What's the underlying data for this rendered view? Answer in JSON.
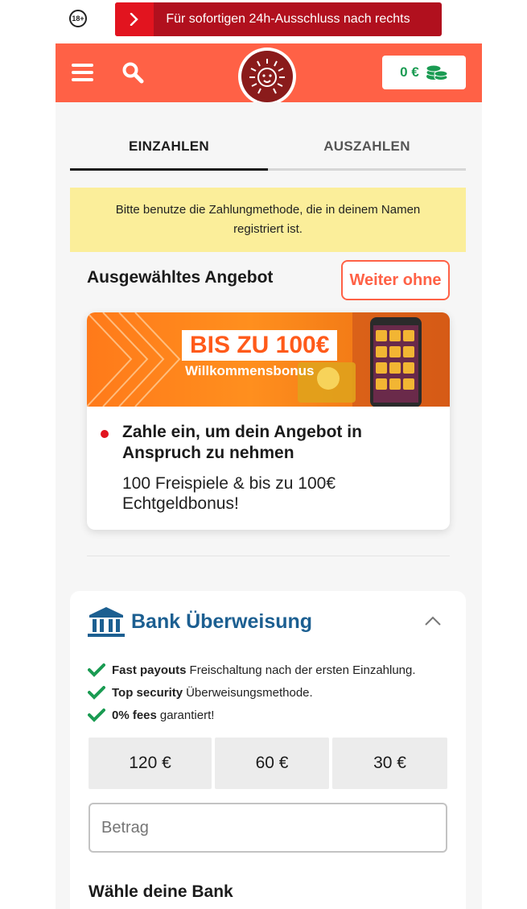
{
  "topbar": {
    "age_badge": "18+",
    "exclusion_text": "Für sofortigen 24h-Ausschluss nach rechts"
  },
  "header": {
    "balance": "0 €",
    "colors": {
      "brand": "#ff6146",
      "balance_green": "#1a9b52"
    }
  },
  "tabs": [
    {
      "label": "EINZAHLEN",
      "active": true
    },
    {
      "label": "AUSZAHLEN",
      "active": false
    }
  ],
  "notice": "Bitte benutze die Zahlungmethode, die in deinem Namen registriert ist.",
  "offer": {
    "section_title": "Ausgewähltes Angebot",
    "skip_label": "Weiter ohne",
    "banner_amount": "BIS ZU 100€",
    "banner_sub": "Willkommensbonus",
    "headline": "Zahle ein, um dein Angebot in Anspruch zu nehmen",
    "description": "100 Freispiele & bis zu 100€ Echtgeldbonus!"
  },
  "bank": {
    "title": "Bank Überweisung",
    "features": [
      {
        "bold": "Fast payouts",
        "text": "Freischaltung nach der ersten Einzahlung."
      },
      {
        "bold": "Top security",
        "text": "Überweisungsmethode."
      },
      {
        "bold": "0% fees",
        "text": "garantiert!"
      }
    ],
    "amounts": [
      "120 €",
      "60 €",
      "30 €"
    ],
    "amount_placeholder": "Betrag",
    "choose_bank_label": "Wähle deine Bank"
  }
}
